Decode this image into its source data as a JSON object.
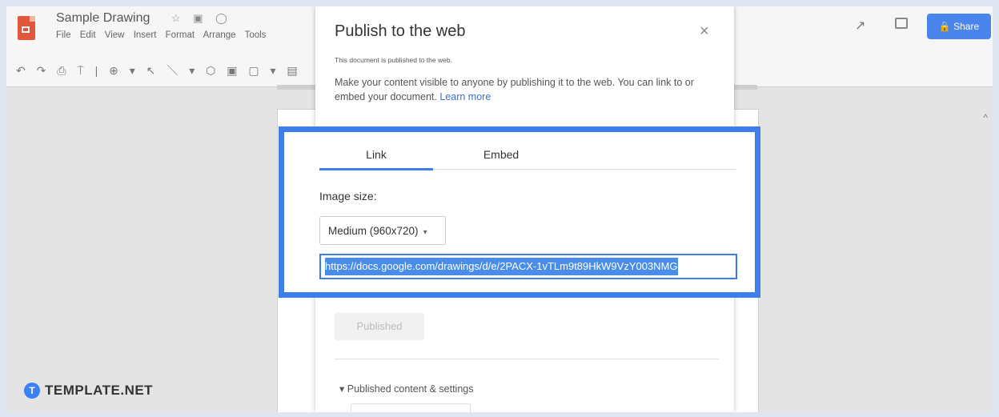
{
  "app": {
    "doc_title": "Sample Drawing",
    "title_icons": "☆ ▣ ◯",
    "menu": [
      "File",
      "Edit",
      "View",
      "Insert",
      "Format",
      "Arrange",
      "Tools"
    ],
    "toolbar_glyphs": "↶ ↷ ⎙ ⍑ | ⊕ ▾ ↖ ＼ ▾ ⬡ ▣ ▢ ▾ ▤",
    "share_label": "🔒 Share"
  },
  "dialog": {
    "title": "Publish to the web",
    "close_glyph": "×",
    "note": "This document is published to the web.",
    "description": "Make your content visible to anyone by publishing it to the web. You can link to or embed your document.",
    "learn_more": "Learn more",
    "tabs": [
      {
        "label": "Link",
        "active": true
      },
      {
        "label": "Embed",
        "active": false
      }
    ],
    "image_size_label": "Image size:",
    "image_size_value": "Medium (960x720)",
    "url": "https://docs.google.com/drawings/d/e/2PACX-1vTLm9t89HkW9VzY003NMG",
    "published_label": "Published",
    "settings_label": "▾ Published content & settings"
  },
  "watermark": {
    "badge": "T",
    "text": "TEMPLATE.NET"
  },
  "colors": {
    "accent": "#3d7fe8",
    "share": "#4a84ed"
  }
}
